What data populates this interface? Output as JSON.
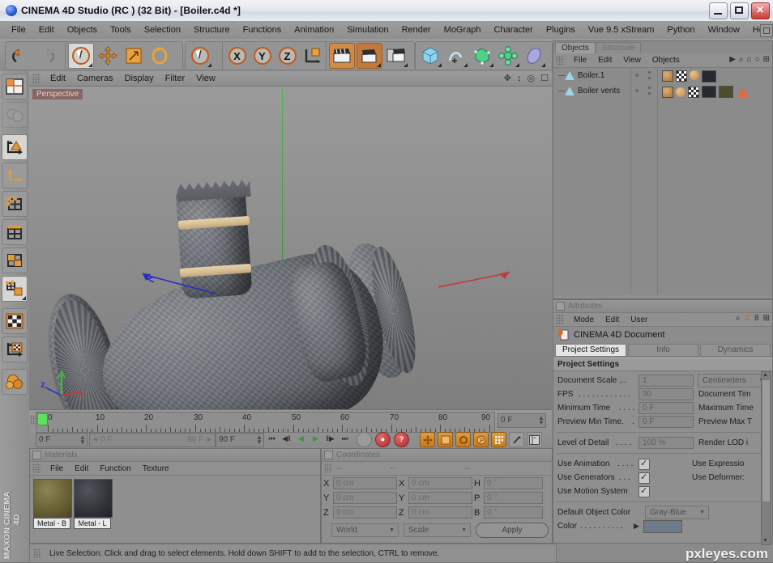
{
  "window": {
    "title": "CINEMA 4D Studio (RC ) (32 Bit) - [Boiler.c4d *]",
    "app_icon": "c4d-sphere-icon",
    "minimize_label": "",
    "maximize_label": "",
    "close_label": "✕"
  },
  "menubar": {
    "items": [
      {
        "label": "File"
      },
      {
        "label": "Edit"
      },
      {
        "label": "Objects"
      },
      {
        "label": "Tools"
      },
      {
        "label": "Selection"
      },
      {
        "label": "Structure"
      },
      {
        "label": "Functions"
      },
      {
        "label": "Animation"
      },
      {
        "label": "Simulation"
      },
      {
        "label": "Render"
      },
      {
        "label": "MoGraph"
      },
      {
        "label": "Character"
      },
      {
        "label": "Plugins"
      },
      {
        "label": "Vue 9.5 xStream"
      },
      {
        "label": "Python"
      },
      {
        "label": "Window"
      },
      {
        "label": "Help"
      }
    ],
    "layout_icon": "layout-grid-icon"
  },
  "toolbar": {
    "groups": [
      {
        "name": "history",
        "items": [
          {
            "icon": "undo-icon",
            "label": ""
          },
          {
            "icon": "redo-icon",
            "label": ""
          }
        ]
      },
      {
        "name": "transform",
        "items": [
          {
            "icon": "live-selection-icon",
            "label": ""
          },
          {
            "icon": "move-icon",
            "label": ""
          },
          {
            "icon": "scale-icon",
            "label": ""
          },
          {
            "icon": "rotate-icon",
            "label": ""
          }
        ]
      },
      {
        "name": "active-tool",
        "items": [
          {
            "icon": "live-selection-icon",
            "label": ""
          }
        ]
      },
      {
        "name": "axis-lock",
        "items": [
          {
            "icon": "lock-x-axis-icon",
            "label": "X"
          },
          {
            "icon": "lock-y-axis-icon",
            "label": "Y"
          },
          {
            "icon": "lock-z-axis-icon",
            "label": "Z"
          },
          {
            "icon": "world-object-coords-icon",
            "label": ""
          }
        ]
      },
      {
        "name": "render",
        "items": [
          {
            "icon": "render-view-icon",
            "label": ""
          },
          {
            "icon": "render-region-icon",
            "label": ""
          },
          {
            "icon": "render-settings-icon",
            "label": ""
          }
        ]
      },
      {
        "name": "primitives",
        "items": [
          {
            "icon": "cube-primitive-icon",
            "label": ""
          },
          {
            "icon": "spline-pen-icon",
            "label": ""
          },
          {
            "icon": "nurbs-icon",
            "label": ""
          },
          {
            "icon": "array-icon",
            "label": ""
          },
          {
            "icon": "deformer-icon",
            "label": ""
          }
        ]
      }
    ]
  },
  "left_toolbar": {
    "items": [
      {
        "icon": "make-editable-icon"
      },
      {
        "icon": "model-mode-icon"
      },
      {
        "icon": "object-axis-icon",
        "active": true
      },
      {
        "icon": "texture-axis-icon"
      },
      {
        "icon": "point-mode-icon"
      },
      {
        "icon": "edge-mode-icon"
      },
      {
        "icon": "polygon-mode-icon"
      },
      {
        "icon": "use-object-tool-icon",
        "active": true
      },
      {
        "icon": "texture-mode-icon"
      },
      {
        "icon": "texture-axis-mode-icon"
      },
      {
        "icon": "enable-axis-icon"
      }
    ],
    "brand_line1": "MAXON",
    "brand_line2": "CINEMA 4D"
  },
  "viewport": {
    "menu": [
      {
        "label": "Edit"
      },
      {
        "label": "Cameras"
      },
      {
        "label": "Display"
      },
      {
        "label": "Filter"
      },
      {
        "label": "View"
      }
    ],
    "icons": [
      {
        "icon": "pan-view-icon"
      },
      {
        "icon": "dolly-view-icon"
      },
      {
        "icon": "rotate-view-icon"
      },
      {
        "icon": "maximize-view-icon"
      }
    ],
    "label": "Perspective",
    "axis_gizmo": {
      "x": "x",
      "y": "y",
      "z": "z"
    },
    "object_name": "Boiler"
  },
  "timeline": {
    "ruler_labels": [
      "0",
      "10",
      "20",
      "30",
      "40",
      "50",
      "60",
      "70",
      "80",
      "90"
    ],
    "current_frame_right": "0 F",
    "current_frame": "0 F",
    "range_start": "0 F",
    "range_end": "90 F",
    "max_frame": "90 F",
    "transport": [
      {
        "icon": "go-to-start-icon",
        "glyph": "⏮"
      },
      {
        "icon": "step-back-icon",
        "glyph": "◀‖"
      },
      {
        "icon": "play-reverse-icon",
        "glyph": "◀"
      },
      {
        "icon": "play-forward-icon",
        "glyph": "▶"
      },
      {
        "icon": "step-forward-icon",
        "glyph": "‖▶"
      },
      {
        "icon": "go-to-end-icon",
        "glyph": "⏭"
      }
    ],
    "record_buttons": [
      {
        "icon": "autokeying-icon",
        "glyph": ""
      },
      {
        "icon": "record-active-objects-icon",
        "glyph": "●"
      },
      {
        "icon": "record-question-icon",
        "glyph": "?"
      }
    ],
    "key_buttons": [
      {
        "icon": "key-position-icon"
      },
      {
        "icon": "key-scale-icon"
      },
      {
        "icon": "key-rotation-icon"
      },
      {
        "icon": "key-parameter-icon",
        "glyph": "P"
      },
      {
        "icon": "key-pla-icon"
      },
      {
        "icon": "animation-mode-icon"
      },
      {
        "icon": "timeline-icon"
      }
    ]
  },
  "materials": {
    "title": "Materials",
    "menu": [
      {
        "label": "File"
      },
      {
        "label": "Edit"
      },
      {
        "label": "Function"
      },
      {
        "label": "Texture"
      }
    ],
    "items": [
      {
        "name": "Metal - B",
        "swatch": "olive-metal"
      },
      {
        "name": "Metal - L",
        "swatch": "dark-metal"
      }
    ]
  },
  "coordinates": {
    "title": "Coordinates",
    "headers": [
      "--",
      "--",
      "--"
    ],
    "rows": [
      {
        "pos_label": "X",
        "pos_value": "0 cm",
        "size_label": "X",
        "size_value": "0 cm",
        "rot_label": "H",
        "rot_value": "0 °"
      },
      {
        "pos_label": "Y",
        "pos_value": "0 cm",
        "size_label": "Y",
        "size_value": "0 cm",
        "rot_label": "P",
        "rot_value": "0 °"
      },
      {
        "pos_label": "Z",
        "pos_value": "0 cm",
        "size_label": "Z",
        "size_value": "0 cm",
        "rot_label": "B",
        "rot_value": "0 °"
      }
    ],
    "system": "World",
    "mode": "Scale",
    "apply_label": "Apply"
  },
  "status": {
    "message": "Live Selection: Click and drag to select elements. Hold down SHIFT to add to the selection, CTRL to remove."
  },
  "objects_panel": {
    "tabs": [
      {
        "label": "Objects",
        "active": true
      },
      {
        "label": "Structure",
        "active": false
      }
    ],
    "menu": [
      {
        "label": "File"
      },
      {
        "label": "Edit"
      },
      {
        "label": "View"
      },
      {
        "label": "Objects"
      }
    ],
    "icons": [
      {
        "icon": "more-arrow-icon",
        "glyph": "▶"
      },
      {
        "icon": "search-icon",
        "glyph": "⌕"
      },
      {
        "icon": "home-icon",
        "glyph": "⌂"
      },
      {
        "icon": "ellipse-icon",
        "glyph": "○"
      },
      {
        "icon": "add-panel-icon",
        "glyph": "⊞"
      }
    ],
    "rows": [
      {
        "name": "Boiler.1",
        "icon": "polygon-object-icon",
        "tags": [
          "texture-tag-icon",
          "checker-tag-icon",
          "material-tag-icon",
          "dark-swatch"
        ]
      },
      {
        "name": "Boiler vents",
        "icon": "polygon-object-icon",
        "tags": [
          "texture-tag-icon",
          "material-tag-icon",
          "checker-tag-icon",
          "dark-swatch",
          "olive-swatch",
          "selection-tag-icon"
        ]
      }
    ]
  },
  "attributes": {
    "title": "Attributes",
    "menu": [
      {
        "label": "Mode"
      },
      {
        "label": "Edit"
      },
      {
        "label": "User"
      }
    ],
    "nav_icons": [
      {
        "icon": "nav-back-icon",
        "glyph": "◀"
      },
      {
        "icon": "nav-up-icon",
        "glyph": "◇"
      },
      {
        "icon": "nav-forward-icon",
        "glyph": "▶"
      },
      {
        "icon": "nav-home-icon",
        "glyph": "△"
      }
    ],
    "tool_icons": [
      {
        "icon": "search-icon",
        "glyph": "⌕"
      },
      {
        "icon": "lock-icon",
        "glyph": "⚿"
      },
      {
        "icon": "link-icon",
        "glyph": "8"
      },
      {
        "icon": "add-panel-icon",
        "glyph": "⊞"
      }
    ],
    "object_icon": "cinema-4d-document-icon",
    "object_name": "CINEMA 4D Document",
    "tabs": [
      {
        "label": "Project Settings",
        "active": true
      },
      {
        "label": "Info",
        "active": false
      },
      {
        "label": "Dynamics",
        "active": false
      }
    ],
    "section_title": "Project Settings",
    "fields": [
      {
        "label": "Document Scale ...",
        "value": "1",
        "type": "spinner",
        "unit_label": "Centimeters",
        "unit_type": "dropdown"
      },
      {
        "label": "FPS",
        "dots": ". . . . . . . . . . . .",
        "value": "30",
        "type": "spinner",
        "right_label": "Document Tim",
        "right_value": ""
      },
      {
        "label": "Minimum Time",
        "dots": ". . . .",
        "value": "0 F",
        "type": "spinner",
        "right_label": "Maximum Time",
        "right_value": ""
      },
      {
        "label": "Preview Min Time.",
        "dots": " .",
        "value": "0 F",
        "type": "spinner",
        "right_label": "Preview Max T",
        "right_value": ""
      },
      {
        "label": "Level of Detail",
        "dots": ". . . .",
        "value": "100 %",
        "type": "spinner",
        "right_label": "Render LOD i",
        "right_value": ""
      }
    ],
    "checkboxes": [
      {
        "label": "Use Animation",
        "dots": ". . . .",
        "checked": true,
        "right_label": "Use Expressio"
      },
      {
        "label": "Use Generators",
        "dots": ". . .",
        "checked": true,
        "right_label": "Use Deformer:"
      },
      {
        "label": "Use Motion System",
        "dots": "",
        "checked": true,
        "right_label": ""
      }
    ],
    "default_object_color_label": "Default Object Color",
    "default_object_color_value": "Gray-Blue",
    "color_label": "Color",
    "color_dots": ". . . . . . . . . .",
    "color_swatch": "#6f7a8a"
  },
  "watermark": {
    "text": "pxleyes.com"
  },
  "colors": {
    "accent_orange": "#d4821f",
    "panel_gray": "#8f8f8f",
    "chrome_gray": "#9a9a9a",
    "viewport_gray": "#8c8c8c",
    "axis_x": "#c33a3a",
    "axis_y": "#3fbb3f",
    "axis_z": "#3a3ac3",
    "band_tan": "#d9c096"
  }
}
